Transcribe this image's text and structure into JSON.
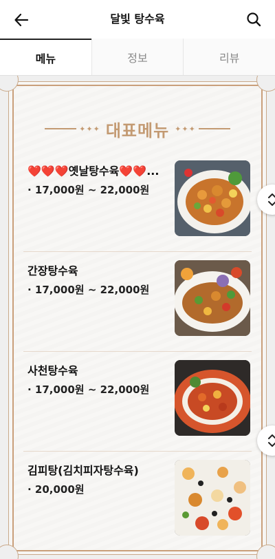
{
  "header": {
    "title": "달빛 탕수육",
    "back_icon": "back-arrow-icon",
    "search_icon": "search-icon"
  },
  "tabs": [
    {
      "label": "메뉴",
      "active": true
    },
    {
      "label": "정보",
      "active": false
    },
    {
      "label": "리뷰",
      "active": false
    }
  ],
  "section": {
    "title": "대표메뉴",
    "accent_color": "#c39a72"
  },
  "menu_items": [
    {
      "name": "❤️❤️❤️옛날탕수육❤️❤️...",
      "price": "· 17,000원 ~ 22,000원",
      "image": "sweet-and-sour-pork-photo"
    },
    {
      "name": "간장탕수육",
      "price": "· 17,000원 ~ 22,000원",
      "image": "soy-sauce-pork-photo"
    },
    {
      "name": "사천탕수육",
      "price": "· 17,000원 ~ 22,000원",
      "image": "sichuan-pork-photo"
    },
    {
      "name": "김피탕(김치피자탕수육)",
      "price": "· 20,000원",
      "image": "kimchi-pizza-pork-photo"
    }
  ],
  "floating_buttons": {
    "icon": "chevron-up-down-icon"
  }
}
